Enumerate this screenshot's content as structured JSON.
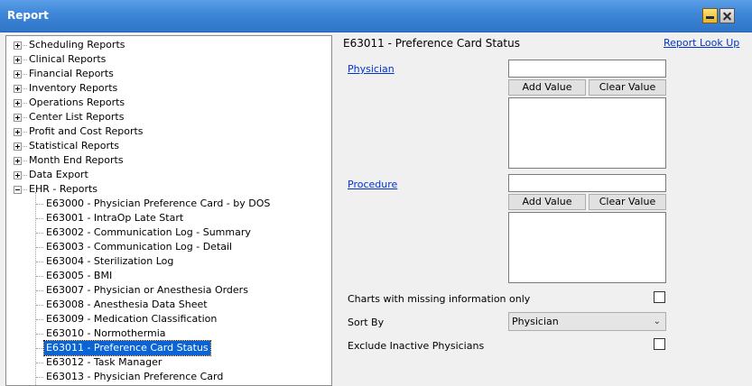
{
  "window": {
    "title": "Report"
  },
  "tree": {
    "categories": [
      "Scheduling Reports",
      "Clinical Reports",
      "Financial Reports",
      "Inventory Reports",
      "Operations Reports",
      "Center List Reports",
      "Profit and Cost Reports",
      "Statistical Reports",
      "Month End Reports",
      "Data Export",
      "EHR - Reports"
    ],
    "ehr_reports": [
      "E63000 - Physician Preference Card - by DOS",
      "E63001 - IntraOp Late Start",
      "E63002 - Communication Log - Summary",
      "E63003 - Communication Log - Detail",
      "E63004 - Sterilization Log",
      "E63005 - BMI",
      "E63007 - Physician or Anesthesia Orders",
      "E63008 - Anesthesia Data Sheet",
      "E63009 - Medication Classification",
      "E63010 - Normothermia",
      "E63011 - Preference Card Status",
      "E63012 - Task Manager",
      "E63013 - Physician Preference Card"
    ],
    "selected_index": 10
  },
  "report": {
    "title": "E63011 - Preference Card Status",
    "lookup_link": "Report Look Up",
    "physician": {
      "label": "Physician",
      "input_value": "",
      "add_label": "Add Value",
      "clear_label": "Clear Value"
    },
    "procedure": {
      "label": "Procedure",
      "input_value": "",
      "add_label": "Add Value",
      "clear_label": "Clear Value"
    },
    "missing_info_label": "Charts with missing information only",
    "missing_info_checked": false,
    "sort_by_label": "Sort By",
    "sort_by_value": "Physician",
    "exclude_inactive_label": "Exclude Inactive Physicians",
    "exclude_inactive_checked": false
  },
  "icons": {
    "minimize": "minimize-icon",
    "close": "close-icon",
    "dropdown": "chevron-down-icon"
  }
}
